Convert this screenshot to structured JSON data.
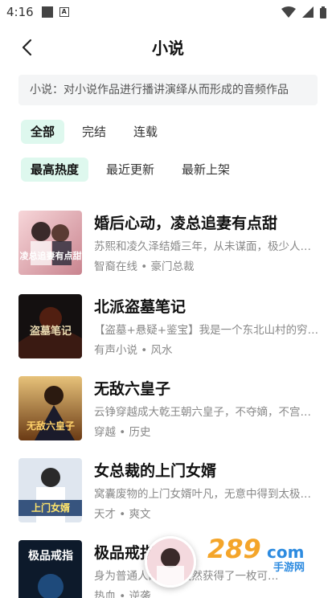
{
  "status_bar": {
    "time": "4:16"
  },
  "nav": {
    "title": "小说"
  },
  "description": "小说：对小说作品进行播讲演绎从而形成的音频作品",
  "status_tabs": [
    {
      "label": "全部",
      "active": true
    },
    {
      "label": "完结",
      "active": false
    },
    {
      "label": "连载",
      "active": false
    }
  ],
  "sort_tabs": [
    {
      "label": "最高热度",
      "active": true
    },
    {
      "label": "最近更新",
      "active": false
    },
    {
      "label": "最新上架",
      "active": false
    }
  ],
  "books": [
    {
      "title": "婚后心动，凌总追妻有点甜",
      "desc": "苏熙和凌久泽结婚三年，从未谋面，极少人…",
      "tags": "智裔在线 • 豪门总裁",
      "cover_text": "凌总追妻有点甜"
    },
    {
      "title": "北派盗墓笔记",
      "desc": "【盗墓+悬疑+鉴宝】我是一个东北山村的穷…",
      "tags": "有声小说 • 风水",
      "cover_text": "盗墓笔记"
    },
    {
      "title": "无敌六皇子",
      "desc": "云铮穿越成大乾王朝六皇子，不夺嫡，不宫…",
      "tags": "穿越 • 历史",
      "cover_text": "无敌六皇子"
    },
    {
      "title": "女总裁的上门女婿",
      "desc": "窝囊废物的上门女婿叶凡，无意中得到太极…",
      "tags": "天才 • 爽文",
      "cover_text": "上门女婿"
    },
    {
      "title": "极品戒指",
      "desc": "身为普通人的某天突然获得了一枚可…",
      "tags": "热血 • 逆袭",
      "cover_text": "极品戒指"
    }
  ],
  "watermark": {
    "number": "289",
    "suffix": "com",
    "sub": "手游网"
  },
  "colors": {
    "accent_bg": "#def8ee",
    "text": "#111111",
    "muted": "#888888"
  }
}
